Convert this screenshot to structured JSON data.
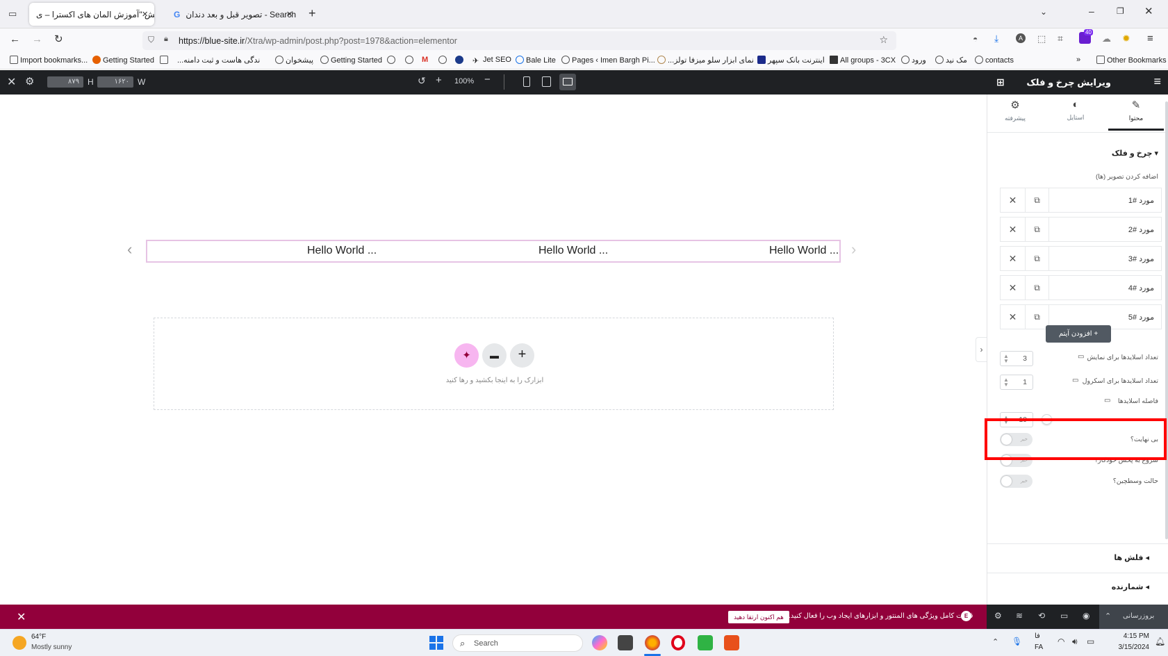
{
  "browser": {
    "tabs": [
      {
        "label": "ویرایش \"آموزش المان های اکسترا – ی"
      },
      {
        "label": "تصویر قبل و بعد دندان - Search"
      }
    ],
    "url_host": "https://blue-site.ir",
    "url_path": "/Xtra/wp-admin/post.php?post=1978&action=elementor",
    "extension_badge": "40",
    "bookmarks": [
      "Import bookmarks...",
      "Getting Started",
      "...ندگی هاست و ثبت دامنه",
      "پیشخوان",
      "Getting Started",
      "Jet SEO",
      "Bale Lite",
      "Pages ‹ Imen Bargh Pi...",
      "...نمای ابزار سلو میزفا تولز",
      "اینترنت بانک سپهر",
      "All groups - 3CX",
      "ورود",
      "مک نید",
      "contacts"
    ],
    "other_bookmarks": "Other Bookmarks"
  },
  "editor_top": {
    "height_label": "H",
    "height_value": "۸۷۹",
    "width_label": "W",
    "width_value": "۱۶۲۰",
    "zoom": "100%"
  },
  "panel": {
    "title": "ویرایش چرخ و فلک",
    "tabs": [
      {
        "label": "محتوا",
        "icon": "pencil-icon"
      },
      {
        "label": "استایل",
        "icon": "half-circle-icon"
      },
      {
        "label": "پیشرفته",
        "icon": "gear-icon"
      }
    ],
    "section_title": "چرخ و فلک",
    "add_images_label": "اضافه کردن تصویر (ها)",
    "items": [
      "مورد #1",
      "مورد #2",
      "مورد #3",
      "مورد #4",
      "مورد #5"
    ],
    "add_item_button": "افزودن آیتم",
    "slides_to_show_label": "تعداد اسلایدها برای نمایش",
    "slides_to_show_value": "3",
    "slides_to_scroll_label": "تعداد اسلایدها برای اسکرول",
    "slides_to_scroll_value": "1",
    "slide_gap_label": "فاصله اسلایدها",
    "slide_gap_value": "10",
    "slide_gap_fraction": 0.05,
    "infinite_label": "بی نهایت؟",
    "autoplay_label": "شروع به پخش خودکار؟",
    "center_mode_label": "حالت وسطچین؟",
    "toggle_off_text": "خیر",
    "arrows_section": "فلش ها",
    "counter_section": "شمارنده"
  },
  "canvas": {
    "carousel_items": [
      "Hello World ...",
      "Hello World ...",
      "Hello World ..."
    ],
    "drop_hint": "ابزارک را به اینجا بکشید و رها کنید"
  },
  "notification": {
    "text": "قدرت کامل ویژگی های المنتور و ابزارهای ایجاد وب را فعال کنید.",
    "button": "هم اکنون ارتقا دهید"
  },
  "panel_footer": {
    "update_button": "بروزرسانی"
  },
  "taskbar": {
    "temperature": "64°F",
    "weather": "Mostly sunny",
    "search_placeholder": "Search",
    "lang1": "فا",
    "lang2": "FA",
    "time": "4:15 PM",
    "date": "3/15/2024"
  },
  "colors": {
    "highlight_box": "#ff0000",
    "notification_bar": "#92003b",
    "editor_dark": "#1f2124",
    "ai_button": "#f7b6f0"
  }
}
